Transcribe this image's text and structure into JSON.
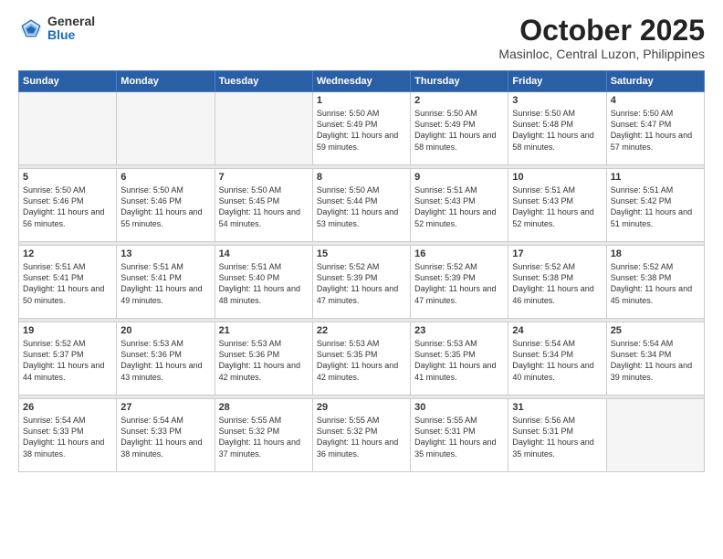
{
  "logo": {
    "general": "General",
    "blue": "Blue"
  },
  "title": "October 2025",
  "subtitle": "Masinloc, Central Luzon, Philippines",
  "weekdays": [
    "Sunday",
    "Monday",
    "Tuesday",
    "Wednesday",
    "Thursday",
    "Friday",
    "Saturday"
  ],
  "weeks": [
    [
      {
        "day": "",
        "sunrise": "",
        "sunset": "",
        "daylight": ""
      },
      {
        "day": "",
        "sunrise": "",
        "sunset": "",
        "daylight": ""
      },
      {
        "day": "",
        "sunrise": "",
        "sunset": "",
        "daylight": ""
      },
      {
        "day": "1",
        "sunrise": "Sunrise: 5:50 AM",
        "sunset": "Sunset: 5:49 PM",
        "daylight": "Daylight: 11 hours and 59 minutes."
      },
      {
        "day": "2",
        "sunrise": "Sunrise: 5:50 AM",
        "sunset": "Sunset: 5:49 PM",
        "daylight": "Daylight: 11 hours and 58 minutes."
      },
      {
        "day": "3",
        "sunrise": "Sunrise: 5:50 AM",
        "sunset": "Sunset: 5:48 PM",
        "daylight": "Daylight: 11 hours and 58 minutes."
      },
      {
        "day": "4",
        "sunrise": "Sunrise: 5:50 AM",
        "sunset": "Sunset: 5:47 PM",
        "daylight": "Daylight: 11 hours and 57 minutes."
      }
    ],
    [
      {
        "day": "5",
        "sunrise": "Sunrise: 5:50 AM",
        "sunset": "Sunset: 5:46 PM",
        "daylight": "Daylight: 11 hours and 56 minutes."
      },
      {
        "day": "6",
        "sunrise": "Sunrise: 5:50 AM",
        "sunset": "Sunset: 5:46 PM",
        "daylight": "Daylight: 11 hours and 55 minutes."
      },
      {
        "day": "7",
        "sunrise": "Sunrise: 5:50 AM",
        "sunset": "Sunset: 5:45 PM",
        "daylight": "Daylight: 11 hours and 54 minutes."
      },
      {
        "day": "8",
        "sunrise": "Sunrise: 5:50 AM",
        "sunset": "Sunset: 5:44 PM",
        "daylight": "Daylight: 11 hours and 53 minutes."
      },
      {
        "day": "9",
        "sunrise": "Sunrise: 5:51 AM",
        "sunset": "Sunset: 5:43 PM",
        "daylight": "Daylight: 11 hours and 52 minutes."
      },
      {
        "day": "10",
        "sunrise": "Sunrise: 5:51 AM",
        "sunset": "Sunset: 5:43 PM",
        "daylight": "Daylight: 11 hours and 52 minutes."
      },
      {
        "day": "11",
        "sunrise": "Sunrise: 5:51 AM",
        "sunset": "Sunset: 5:42 PM",
        "daylight": "Daylight: 11 hours and 51 minutes."
      }
    ],
    [
      {
        "day": "12",
        "sunrise": "Sunrise: 5:51 AM",
        "sunset": "Sunset: 5:41 PM",
        "daylight": "Daylight: 11 hours and 50 minutes."
      },
      {
        "day": "13",
        "sunrise": "Sunrise: 5:51 AM",
        "sunset": "Sunset: 5:41 PM",
        "daylight": "Daylight: 11 hours and 49 minutes."
      },
      {
        "day": "14",
        "sunrise": "Sunrise: 5:51 AM",
        "sunset": "Sunset: 5:40 PM",
        "daylight": "Daylight: 11 hours and 48 minutes."
      },
      {
        "day": "15",
        "sunrise": "Sunrise: 5:52 AM",
        "sunset": "Sunset: 5:39 PM",
        "daylight": "Daylight: 11 hours and 47 minutes."
      },
      {
        "day": "16",
        "sunrise": "Sunrise: 5:52 AM",
        "sunset": "Sunset: 5:39 PM",
        "daylight": "Daylight: 11 hours and 47 minutes."
      },
      {
        "day": "17",
        "sunrise": "Sunrise: 5:52 AM",
        "sunset": "Sunset: 5:38 PM",
        "daylight": "Daylight: 11 hours and 46 minutes."
      },
      {
        "day": "18",
        "sunrise": "Sunrise: 5:52 AM",
        "sunset": "Sunset: 5:38 PM",
        "daylight": "Daylight: 11 hours and 45 minutes."
      }
    ],
    [
      {
        "day": "19",
        "sunrise": "Sunrise: 5:52 AM",
        "sunset": "Sunset: 5:37 PM",
        "daylight": "Daylight: 11 hours and 44 minutes."
      },
      {
        "day": "20",
        "sunrise": "Sunrise: 5:53 AM",
        "sunset": "Sunset: 5:36 PM",
        "daylight": "Daylight: 11 hours and 43 minutes."
      },
      {
        "day": "21",
        "sunrise": "Sunrise: 5:53 AM",
        "sunset": "Sunset: 5:36 PM",
        "daylight": "Daylight: 11 hours and 42 minutes."
      },
      {
        "day": "22",
        "sunrise": "Sunrise: 5:53 AM",
        "sunset": "Sunset: 5:35 PM",
        "daylight": "Daylight: 11 hours and 42 minutes."
      },
      {
        "day": "23",
        "sunrise": "Sunrise: 5:53 AM",
        "sunset": "Sunset: 5:35 PM",
        "daylight": "Daylight: 11 hours and 41 minutes."
      },
      {
        "day": "24",
        "sunrise": "Sunrise: 5:54 AM",
        "sunset": "Sunset: 5:34 PM",
        "daylight": "Daylight: 11 hours and 40 minutes."
      },
      {
        "day": "25",
        "sunrise": "Sunrise: 5:54 AM",
        "sunset": "Sunset: 5:34 PM",
        "daylight": "Daylight: 11 hours and 39 minutes."
      }
    ],
    [
      {
        "day": "26",
        "sunrise": "Sunrise: 5:54 AM",
        "sunset": "Sunset: 5:33 PM",
        "daylight": "Daylight: 11 hours and 38 minutes."
      },
      {
        "day": "27",
        "sunrise": "Sunrise: 5:54 AM",
        "sunset": "Sunset: 5:33 PM",
        "daylight": "Daylight: 11 hours and 38 minutes."
      },
      {
        "day": "28",
        "sunrise": "Sunrise: 5:55 AM",
        "sunset": "Sunset: 5:32 PM",
        "daylight": "Daylight: 11 hours and 37 minutes."
      },
      {
        "day": "29",
        "sunrise": "Sunrise: 5:55 AM",
        "sunset": "Sunset: 5:32 PM",
        "daylight": "Daylight: 11 hours and 36 minutes."
      },
      {
        "day": "30",
        "sunrise": "Sunrise: 5:55 AM",
        "sunset": "Sunset: 5:31 PM",
        "daylight": "Daylight: 11 hours and 35 minutes."
      },
      {
        "day": "31",
        "sunrise": "Sunrise: 5:56 AM",
        "sunset": "Sunset: 5:31 PM",
        "daylight": "Daylight: 11 hours and 35 minutes."
      },
      {
        "day": "",
        "sunrise": "",
        "sunset": "",
        "daylight": ""
      }
    ]
  ]
}
